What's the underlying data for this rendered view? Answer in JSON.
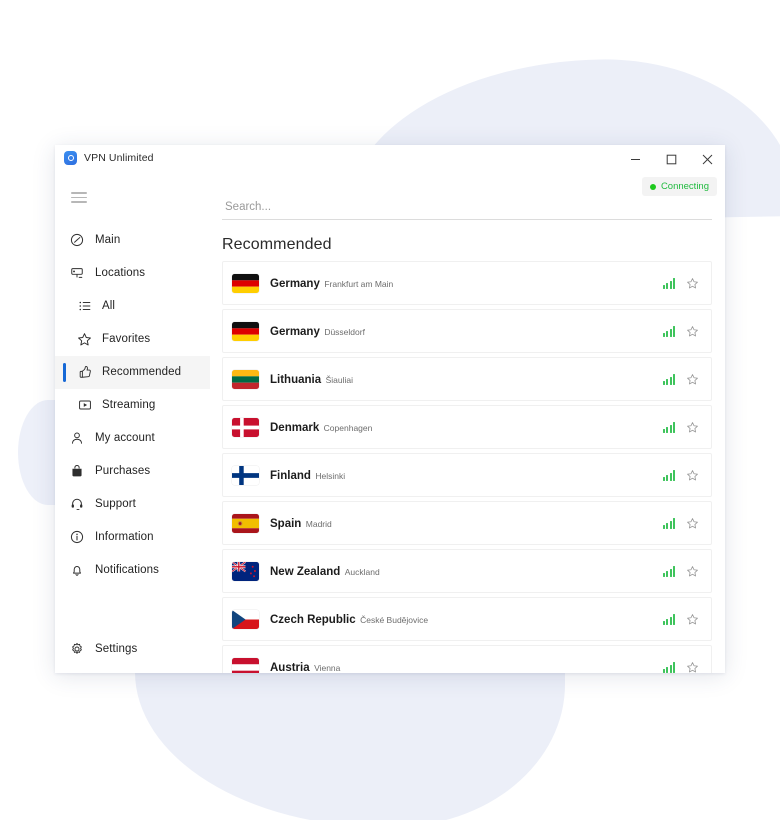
{
  "window": {
    "app_title": "VPN Unlimited",
    "logo_icon": "vpn-shield-logo",
    "controls": {
      "minimize": "minimize-icon",
      "maximize": "maximize-icon",
      "close": "close-icon"
    }
  },
  "status": {
    "label": "Connecting",
    "dot_color": "#1ec91e",
    "text_color": "#21bb3f"
  },
  "sidebar": {
    "menu_icon": "hamburger-menu-icon",
    "items": [
      {
        "label": "Main",
        "icon": "speedometer-icon",
        "indent": false,
        "active": false
      },
      {
        "label": "Locations",
        "icon": "server-icon",
        "indent": false,
        "active": false
      },
      {
        "label": "All",
        "icon": "list-icon",
        "indent": true,
        "active": false
      },
      {
        "label": "Favorites",
        "icon": "star-icon",
        "indent": true,
        "active": false
      },
      {
        "label": "Recommended",
        "icon": "thumbs-up-icon",
        "indent": true,
        "active": true
      },
      {
        "label": "Streaming",
        "icon": "play-box-icon",
        "indent": true,
        "active": false
      },
      {
        "label": "My account",
        "icon": "person-icon",
        "indent": false,
        "active": false
      },
      {
        "label": "Purchases",
        "icon": "bag-icon",
        "indent": false,
        "active": false
      },
      {
        "label": "Support",
        "icon": "headset-icon",
        "indent": false,
        "active": false
      },
      {
        "label": "Information",
        "icon": "info-circle-icon",
        "indent": false,
        "active": false
      },
      {
        "label": "Notifications",
        "icon": "bell-icon",
        "indent": false,
        "active": false
      }
    ],
    "settings": {
      "label": "Settings",
      "icon": "gear-icon"
    }
  },
  "search": {
    "placeholder": "Search...",
    "value": ""
  },
  "main": {
    "section_title": "Recommended",
    "servers": [
      {
        "country": "Germany",
        "city": "Frankfurt am Main",
        "flag": "de",
        "signal": 4,
        "favorite": false
      },
      {
        "country": "Germany",
        "city": "Düsseldorf",
        "flag": "de",
        "signal": 4,
        "favorite": false
      },
      {
        "country": "Lithuania",
        "city": "Šiauliai",
        "flag": "lt",
        "signal": 4,
        "favorite": false
      },
      {
        "country": "Denmark",
        "city": "Copenhagen",
        "flag": "dk",
        "signal": 4,
        "favorite": false
      },
      {
        "country": "Finland",
        "city": "Helsinki",
        "flag": "fi",
        "signal": 4,
        "favorite": false
      },
      {
        "country": "Spain",
        "city": "Madrid",
        "flag": "es",
        "signal": 4,
        "favorite": false
      },
      {
        "country": "New Zealand",
        "city": "Auckland",
        "flag": "nz",
        "signal": 4,
        "favorite": false
      },
      {
        "country": "Czech Republic",
        "city": "České Budějovice",
        "flag": "cz",
        "signal": 4,
        "favorite": false
      },
      {
        "country": "Austria",
        "city": "Vienna",
        "flag": "at",
        "signal": 4,
        "favorite": false
      }
    ]
  },
  "theme": {
    "accent": "#1668d6",
    "signal_green": "#3ec45c",
    "background_blob": "#eceff8"
  }
}
